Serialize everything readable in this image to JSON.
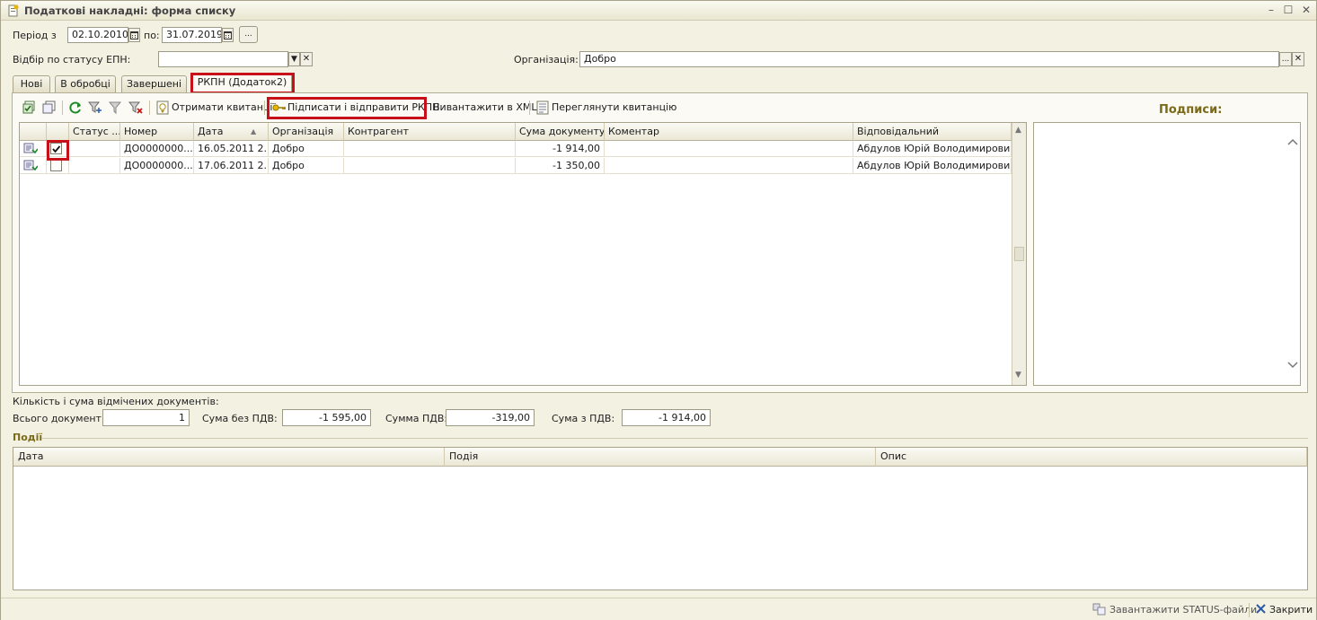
{
  "window": {
    "title": "Податкові накладні: форма списку"
  },
  "period": {
    "from_label": "Період з",
    "from_value": "02.10.2010",
    "to_label": "по:",
    "to_value": "31.07.2019",
    "more_btn": "..."
  },
  "filter": {
    "status_label": "Відбір по статусу ЕПН:",
    "status_value": "",
    "org_label": "Організація:",
    "org_value": "Добро"
  },
  "tabs": [
    {
      "label": "Нові"
    },
    {
      "label": "В обробці"
    },
    {
      "label": "Завершені"
    },
    {
      "label": "РКПН (Додаток2)"
    }
  ],
  "toolbar": {
    "receive_receipts": "Отримати квитанції",
    "sign_send": "Підписати і відправити РКПН",
    "export_xml": "Вивантажити в XML",
    "view_receipt": "Переглянути квитанцію"
  },
  "grid": {
    "columns": [
      "Статус ...",
      "Номер",
      "Дата",
      "Організація",
      "Контрагент",
      "Сума документу",
      "Коментар",
      "Відповідальний"
    ],
    "rows": [
      {
        "checked": true,
        "status": "",
        "number": "ДО0000000...",
        "date": "16.05.2011 2...",
        "org": "Добро",
        "counterparty": "",
        "sum": "-1 914,00",
        "comment": "",
        "responsible": "Абдулов Юрій Володимирович"
      },
      {
        "checked": false,
        "status": "",
        "number": "ДО0000000...",
        "date": "17.06.2011 2...",
        "org": "Добро",
        "counterparty": "",
        "sum": "-1 350,00",
        "comment": "",
        "responsible": "Абдулов Юрій Володимирович"
      }
    ]
  },
  "signatures": {
    "title": "Подписи:"
  },
  "summary": {
    "caption": "Кількість і сума відмічених документів:",
    "count_label": "Всього документ...",
    "count_value": "1",
    "sum_no_vat_label": "Сума без ПДВ:",
    "sum_no_vat_value": "-1 595,00",
    "vat_label": "Сумма ПДВ:",
    "vat_value": "-319,00",
    "sum_vat_label": "Сума з ПДВ:",
    "sum_vat_value": "-1 914,00"
  },
  "events": {
    "title": "Події",
    "columns": [
      "Дата",
      "Подія",
      "Опис"
    ]
  },
  "footer": {
    "load_status": "Завантажити STATUS-файли",
    "close": "Закрити"
  },
  "colors": {
    "highlight_red": "#c8101a",
    "accent_gold": "#7a6a18",
    "window_bg": "#f3f1e2"
  }
}
